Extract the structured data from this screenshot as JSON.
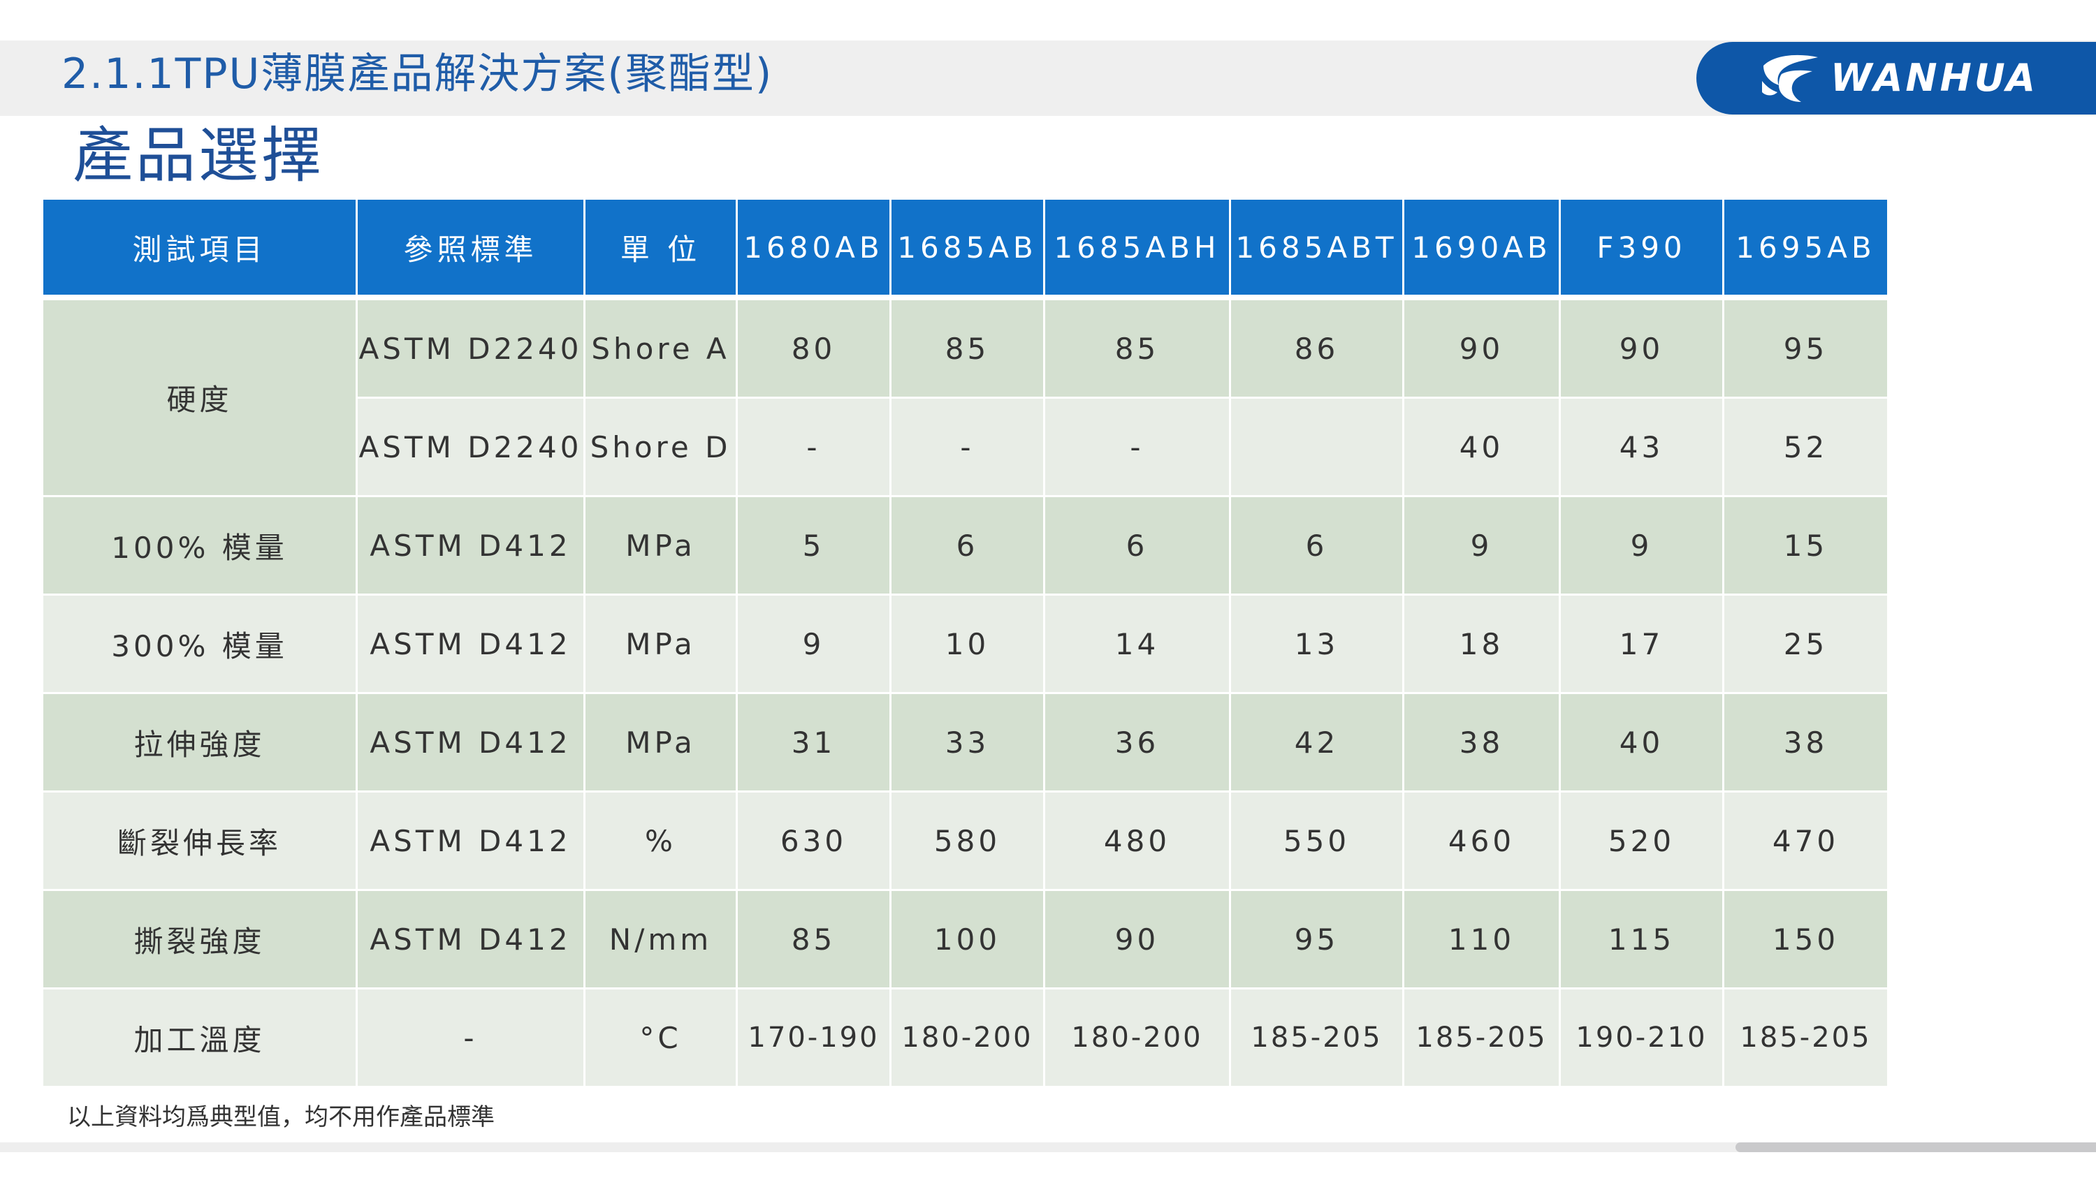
{
  "header": {
    "section_title": "2.1.1TPU薄膜產品解決方案(聚酯型)",
    "logo_text": "WANHUA",
    "logo_icon": "wanhua-logo-icon"
  },
  "page_title": "產品選擇",
  "colors": {
    "header_blue": "#1172c9",
    "logo_blue": "#0e57a8",
    "row_dark": "#d4e0d0",
    "row_light": "#e8ede6",
    "title_blue": "#1f5ca8"
  },
  "table": {
    "columns": [
      "測試項目",
      "參照標準",
      "單 位",
      "1680AB",
      "1685AB",
      "1685ABH",
      "1685ABT",
      "1690AB",
      "F390",
      "1695AB"
    ],
    "rows": [
      {
        "item": "硬度",
        "standard": "ASTM D2240",
        "unit": "Shore A",
        "values": [
          "80",
          "85",
          "85",
          "86",
          "90",
          "90",
          "95"
        ]
      },
      {
        "item": "",
        "standard": "ASTM D2240",
        "unit": "Shore D",
        "values": [
          "-",
          "-",
          "-",
          "",
          "40",
          "43",
          "52"
        ]
      },
      {
        "item": "100% 模量",
        "standard": "ASTM D412",
        "unit": "MPa",
        "values": [
          "5",
          "6",
          "6",
          "6",
          "9",
          "9",
          "15"
        ]
      },
      {
        "item": "300% 模量",
        "standard": "ASTM D412",
        "unit": "MPa",
        "values": [
          "9",
          "10",
          "14",
          "13",
          "18",
          "17",
          "25"
        ]
      },
      {
        "item": "拉伸強度",
        "standard": "ASTM D412",
        "unit": "MPa",
        "values": [
          "31",
          "33",
          "36",
          "42",
          "38",
          "40",
          "38"
        ]
      },
      {
        "item": "斷裂伸長率",
        "standard": "ASTM D412",
        "unit": "%",
        "values": [
          "630",
          "580",
          "480",
          "550",
          "460",
          "520",
          "470"
        ]
      },
      {
        "item": "撕裂強度",
        "standard": "ASTM D412",
        "unit": "N/mm",
        "values": [
          "85",
          "100",
          "90",
          "95",
          "110",
          "115",
          "150"
        ]
      },
      {
        "item": "加工溫度",
        "standard": "-",
        "unit": "°C",
        "values": [
          "170-190",
          "180-200",
          "180-200",
          "185-205",
          "185-205",
          "190-210",
          "185-205"
        ]
      }
    ]
  },
  "footnote": "以上資料均爲典型值，均不用作產品標準"
}
